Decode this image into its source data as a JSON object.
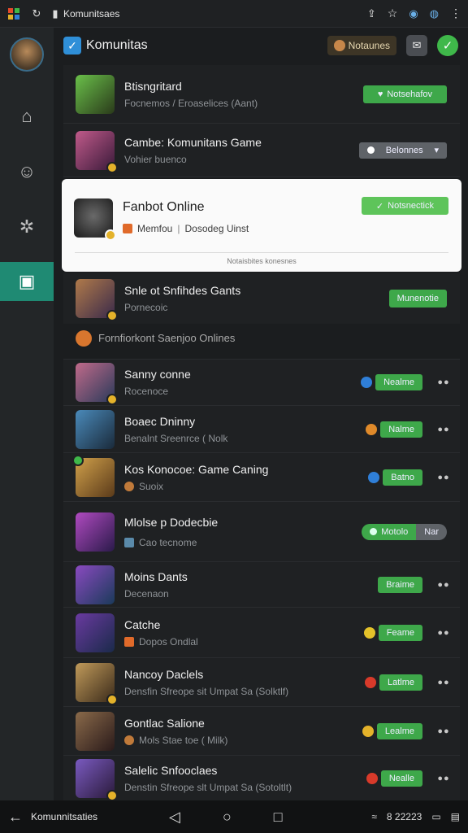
{
  "browser": {
    "title": "Komunitsaes"
  },
  "header": {
    "title": "Komunitas",
    "notif_label": "Notaunes"
  },
  "rows": [
    {
      "title": "Btisngritard",
      "sub": "Focnemos  /  Eroaselices (Aant)",
      "status": "Notsehafov",
      "colors": {
        "thumb": "#3b5a2a",
        "accent": "#6ac04a"
      }
    },
    {
      "title": "Cambe: Komunitans Game",
      "sub": "Vohier buenco",
      "status": "Belonnes",
      "colors": {
        "thumb": "#6b3b6e",
        "accent": "#e4b22a"
      }
    },
    {
      "title": "Fanbot Online",
      "sub_a": "Memfou",
      "sub_b": "Dosodeg Uinst",
      "status": "Notsnectick",
      "footer": "Notaisbites konesnes",
      "colors": {
        "thumb": "#5a5a5a"
      }
    },
    {
      "title": "Snle ot Snfihdes Gants",
      "sub": "Pornecoic",
      "status": "Munenotie",
      "colors": {
        "thumb": "#7a4a2a"
      }
    },
    {
      "title": "Fornfiorkont Saenjoo Onlines",
      "colors": {
        "ico": "#d8762e"
      }
    },
    {
      "title": "Sanny conne",
      "sub": "Rocenoce",
      "status": "Nealme",
      "colors": {
        "thumb": "#5a3a6a",
        "lead": "#2f7fd8"
      }
    },
    {
      "title": "Boaec Dninny",
      "sub": "Benalnt Sreenrce ( Nolk",
      "status": "Nalme",
      "colors": {
        "thumb": "#2a4a5a",
        "lead": "#e08a2a"
      }
    },
    {
      "title": "Kos Konocoe: Game Caning",
      "sub": "Suoix",
      "status": "Batno",
      "colors": {
        "thumb": "#7a5a2a",
        "lead": "#2f7fd8"
      }
    },
    {
      "title": "Mlolse p Dodecbie",
      "sub": "Cao tecnome",
      "status_a": "Motolo",
      "status_b": "Nar",
      "colors": {
        "thumb": "#4a3a7a"
      }
    },
    {
      "title": "Moins Dants",
      "sub": "Decenaon",
      "status": "Braime",
      "colors": {
        "thumb": "#3a4a8a"
      }
    },
    {
      "title": "Catche",
      "sub": "Dopos Ondlal",
      "status": "Feame",
      "colors": {
        "thumb": "#5a2a6a",
        "lead": "#e4c22a"
      }
    },
    {
      "title": "Nancoy Daclels",
      "sub": "Densfin Sfreope sit Umpat Sa (Solktlf)",
      "status": "Latlme",
      "colors": {
        "thumb": "#7a5a3a",
        "lead": "#d83a2a"
      }
    },
    {
      "title": "Gontlac Salione",
      "sub": "Mols Stae toe ( Milk)",
      "status": "Lealme",
      "colors": {
        "thumb": "#4a3a2a",
        "lead": "#e4b22a"
      }
    },
    {
      "title": "Salelic Snfooclaes",
      "sub": "Denstin Sfreope slt Umpat Sa (Sotoltlt)",
      "status": "Nealle",
      "colors": {
        "thumb": "#3a3a6a",
        "lead": "#d83a2a"
      }
    }
  ],
  "navbar": {
    "title": "Komunnitsaties",
    "right_text": "8 22223"
  }
}
